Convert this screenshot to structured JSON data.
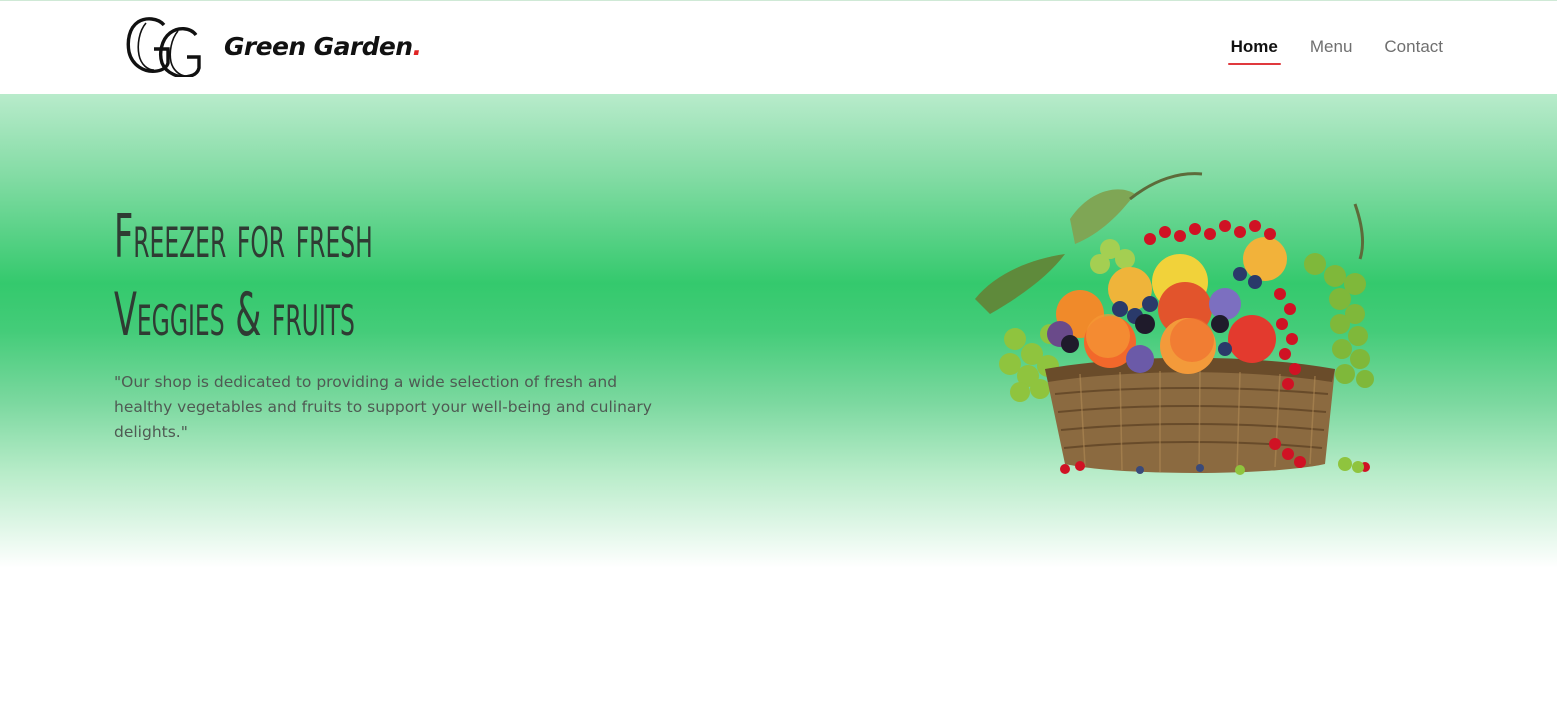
{
  "header": {
    "brand": "Green Garden",
    "brand_dot": ".",
    "logo_icon": "gg-monogram-logo",
    "nav": [
      {
        "label": "Home",
        "active": true
      },
      {
        "label": "Menu",
        "active": false
      },
      {
        "label": "Contact",
        "active": false
      }
    ]
  },
  "hero": {
    "title_line1": "Freezer for fresh",
    "title_line2": "Veggies & fruits",
    "description": "\"Our shop is dedicated to providing a wide selection of fresh and healthy vegetables and fruits to support your well-being and culinary delights.\"",
    "image": "fruit-basket-illustration"
  },
  "colors": {
    "accent": "#e0393e",
    "hero_green": "#34c96d",
    "text_dark": "#2f3b33"
  }
}
